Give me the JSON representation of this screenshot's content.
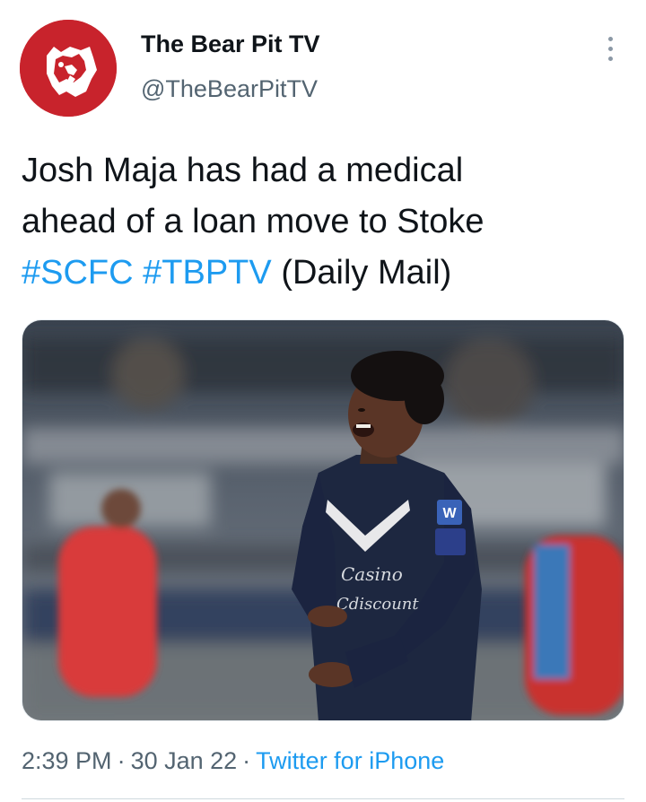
{
  "author": {
    "display_name": "The Bear Pit TV",
    "handle": "@TheBearPitTV",
    "avatar_icon": "bear-logo-icon",
    "avatar_color": "#c8232c"
  },
  "more_icon": "more-vertical-icon",
  "tweet": {
    "line1": "Josh Maja has had a medical",
    "line2": "ahead of a loan move to Stoke",
    "hashtag1": "#SCFC",
    "hashtag2": "#TBPTV",
    "line3_suffix": "(Daily Mail)"
  },
  "media": {
    "shirt_sponsor_1": "Casino",
    "shirt_sponsor_2": "Cdiscount",
    "sleeve_patch": "W"
  },
  "meta": {
    "time": "2:39 PM",
    "separator": "·",
    "date": "30 Jan 22",
    "source": "Twitter for iPhone"
  },
  "colors": {
    "link": "#1d9bf0",
    "secondary_text": "#536471",
    "primary_text": "#0f1419"
  }
}
